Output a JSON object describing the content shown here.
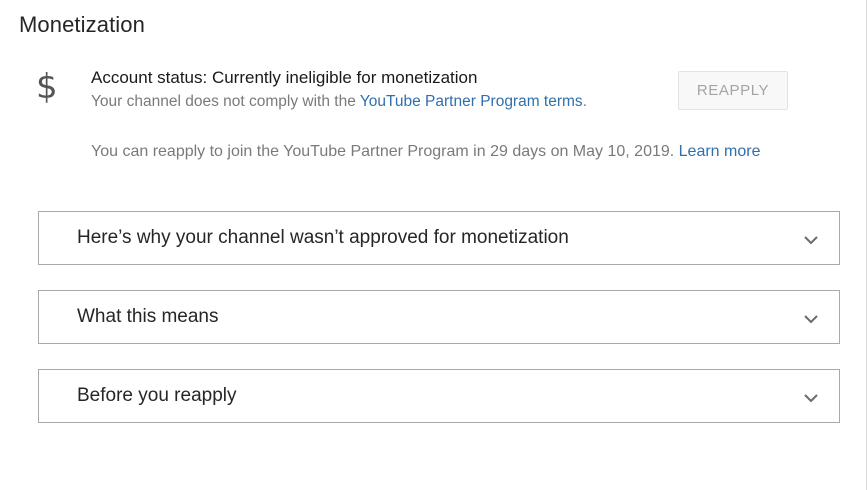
{
  "section": {
    "title": "Monetization"
  },
  "status": {
    "icon": "dollar-icon",
    "icon_glyph": "$",
    "line": "Account status: Currently ineligible for monetization",
    "comply_prefix": "Your channel does not comply with the ",
    "comply_link": "YouTube Partner Program terms",
    "comply_suffix": "."
  },
  "reapply_button": {
    "label": "REAPPLY"
  },
  "reapply_info": {
    "text": "You can reapply to join the YouTube Partner Program in 29 days on May 10, 2019. ",
    "link": "Learn more"
  },
  "accordions": [
    {
      "label": "Here’s why your channel wasn’t approved for monetization",
      "icon": "chevron-down-icon"
    },
    {
      "label": "What this means",
      "icon": "chevron-down-icon"
    },
    {
      "label": "Before you reapply",
      "icon": "chevron-down-icon"
    }
  ],
  "colors": {
    "link": "#2f6fae",
    "border": "#a9a9a9",
    "muted_text": "#7a7a7a"
  }
}
